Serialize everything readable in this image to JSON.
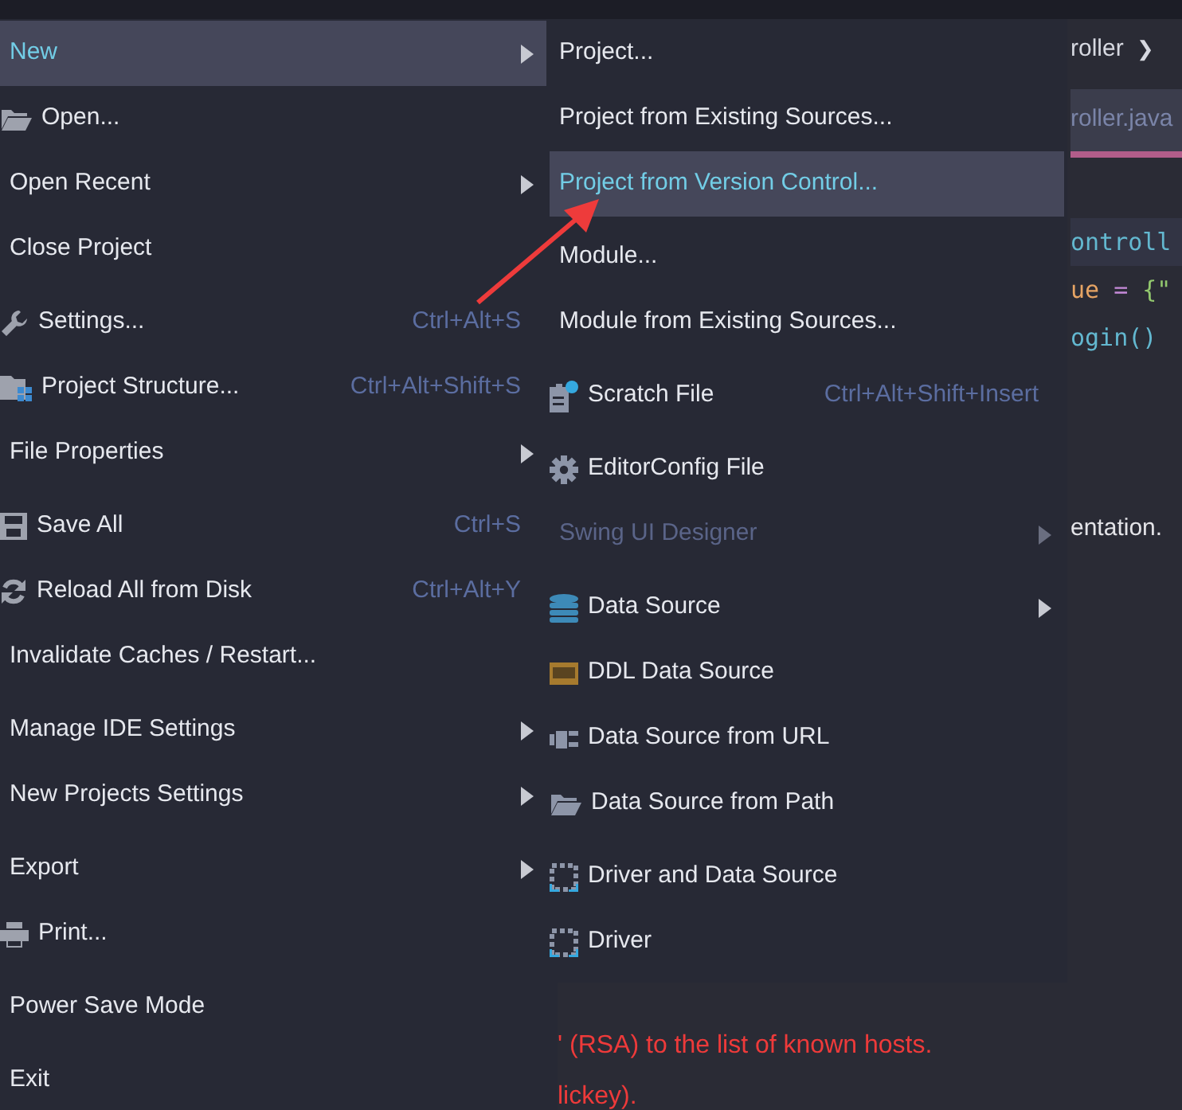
{
  "editor": {
    "breadcrumb": "roller",
    "breadcrumb_arrow": "❯",
    "tab": {
      "label": "roller.java",
      "selected": true
    },
    "code_lines": [
      {
        "kind": "class",
        "text": "ontroll"
      },
      {
        "kind": "value",
        "parts": [
          "ue",
          " = ",
          "{\""
        ]
      },
      {
        "kind": "call",
        "text": "ogin() "
      },
      {
        "kind": "plain",
        "text": "entation."
      }
    ],
    "console_lines": [
      "' (RSA) to the list of known hosts.",
      "lickey)."
    ]
  },
  "file_menu": {
    "groups": [
      [
        {
          "label": "New",
          "submenu": true,
          "selected": true
        },
        {
          "label": "Open...",
          "submenu": false,
          "selected": false
        },
        {
          "label": "Open Recent",
          "submenu": true,
          "selected": false
        },
        {
          "label": "Close Project",
          "submenu": false,
          "selected": false
        }
      ],
      [
        {
          "label": "Settings...",
          "shortcut": "Ctrl+Alt+S",
          "submenu": false,
          "selected": false
        },
        {
          "label": "Project Structure...",
          "shortcut": "Ctrl+Alt+Shift+S",
          "submenu": false,
          "selected": false
        },
        {
          "label": "File Properties",
          "submenu": true,
          "selected": false
        }
      ],
      [
        {
          "label": "Save All",
          "shortcut": "Ctrl+S",
          "submenu": false,
          "selected": false
        },
        {
          "label": "Reload All from Disk",
          "shortcut": "Ctrl+Alt+Y",
          "submenu": false,
          "selected": false
        },
        {
          "label": "Invalidate Caches / Restart...",
          "submenu": false,
          "selected": false
        }
      ],
      [
        {
          "label": "Manage IDE Settings",
          "submenu": true,
          "selected": false
        },
        {
          "label": "New Projects Settings",
          "submenu": true,
          "selected": false
        }
      ],
      [
        {
          "label": "Export",
          "submenu": true,
          "selected": false
        },
        {
          "label": "Print...",
          "submenu": false,
          "selected": false
        }
      ],
      [
        {
          "label": "Power Save Mode",
          "submenu": false,
          "selected": false
        }
      ],
      [
        {
          "label": "Exit",
          "submenu": false,
          "selected": false
        }
      ]
    ]
  },
  "new_submenu": {
    "groups": [
      [
        {
          "label": "Project...",
          "submenu": false,
          "selected": false,
          "disabled": false
        },
        {
          "label": "Project from Existing Sources...",
          "submenu": false,
          "selected": false,
          "disabled": false
        },
        {
          "label": "Project from Version Control...",
          "submenu": false,
          "selected": true,
          "disabled": false
        }
      ],
      [
        {
          "label": "Module...",
          "submenu": false,
          "selected": false,
          "disabled": false
        },
        {
          "label": "Module from Existing Sources...",
          "submenu": false,
          "selected": false,
          "disabled": false
        }
      ],
      [
        {
          "label": "Scratch File",
          "shortcut": "Ctrl+Alt+Shift+Insert",
          "submenu": false,
          "selected": false,
          "disabled": false
        }
      ],
      [
        {
          "label": "EditorConfig File",
          "submenu": false,
          "selected": false,
          "disabled": false
        },
        {
          "label": "Swing UI Designer",
          "submenu": true,
          "selected": false,
          "disabled": true
        }
      ],
      [
        {
          "label": "Data Source",
          "submenu": true,
          "selected": false,
          "disabled": false
        },
        {
          "label": "DDL Data Source",
          "submenu": false,
          "selected": false,
          "disabled": false
        },
        {
          "label": "Data Source from URL",
          "submenu": false,
          "selected": false,
          "disabled": false
        },
        {
          "label": "Data Source from Path",
          "submenu": false,
          "selected": false,
          "disabled": false
        }
      ],
      [
        {
          "label": "Driver and Data Source",
          "submenu": false,
          "selected": false,
          "disabled": false
        },
        {
          "label": "Driver",
          "submenu": false,
          "selected": false,
          "disabled": false
        }
      ]
    ]
  }
}
